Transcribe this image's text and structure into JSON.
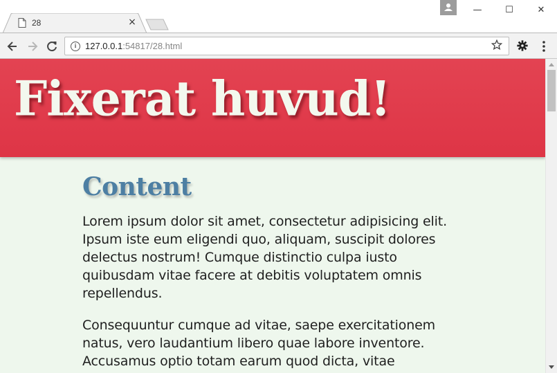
{
  "browser": {
    "tab_title": "28",
    "tab_close_glyph": "×",
    "url_host": "127.0.0.1",
    "url_rest": ":54817/28.html",
    "window_controls": {
      "minimize": "—",
      "maximize": "☐",
      "close": "✕"
    },
    "icons": {
      "favicon": "page-icon",
      "back": "arrow-left-icon",
      "forward": "arrow-right-icon",
      "reload": "reload-icon",
      "info": "info-icon",
      "bookmark": "star-icon",
      "extension": "gear-icon",
      "menu": "kebab-menu-icon"
    }
  },
  "page": {
    "header_title": "Fixerat huvud!",
    "content_heading": "Content",
    "paragraphs": [
      "Lorem ipsum dolor sit amet, consectetur adipisicing elit. Ipsum iste eum eligendi quo, aliquam, suscipit dolores delectus nostrum! Cumque distinctio culpa iusto quibusdam vitae facere at debitis voluptatem omnis repellendus.",
      "Consequuntur cumque ad vitae, saepe exercitationem natus, vero laudantium libero quae labore inventore. Accusamus optio totam earum quod dicta, vitae"
    ],
    "colors": {
      "header_bg": "#e1384a",
      "header_text": "#f3f8ee",
      "heading": "#4d7fa3",
      "body_bg": "#eef7ed"
    }
  }
}
